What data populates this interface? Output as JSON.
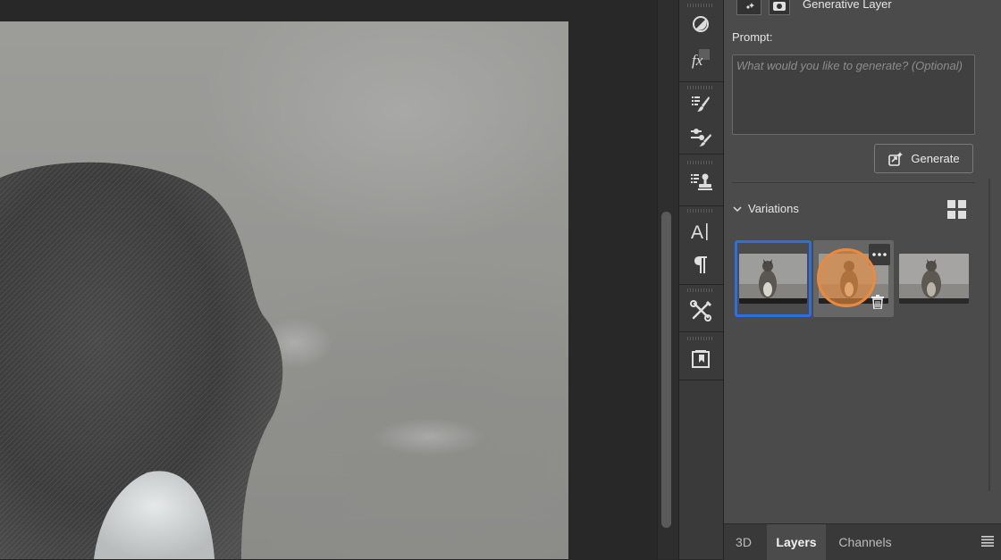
{
  "panel": {
    "header_label": "Generative Layer",
    "prompt_label": "Prompt:",
    "prompt_value": "",
    "prompt_placeholder": "What would you like to generate? (Optional)",
    "generate_label": "Generate",
    "variations_label": "Variations",
    "variations": [
      {
        "selected": true
      },
      {
        "selected": false,
        "hovered": true
      },
      {
        "selected": false
      }
    ]
  },
  "tools": [
    {
      "icon": "adjustment-circle-icon"
    },
    {
      "icon": "fx-styles-icon"
    },
    {
      "icon": "brush-presets-icon"
    },
    {
      "icon": "brush-settings-icon"
    },
    {
      "icon": "clone-source-icon"
    },
    {
      "icon": "character-icon"
    },
    {
      "icon": "paragraph-icon"
    },
    {
      "icon": "tools-icon"
    },
    {
      "icon": "properties-icon"
    }
  ],
  "tabs": [
    {
      "label": "3D"
    },
    {
      "label": "Layers"
    },
    {
      "label": "Channels"
    }
  ],
  "colors": {
    "selection_border": "#2b6fe0",
    "hover_cursor": "#e98a3c",
    "panel_bg": "#4b4b4b"
  }
}
